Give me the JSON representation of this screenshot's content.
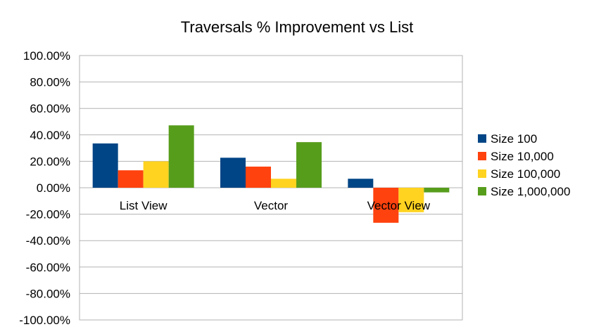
{
  "chart_data": {
    "type": "bar",
    "title": "Traversals % Improvement vs List",
    "categories": [
      "List View",
      "Vector",
      "Vector View"
    ],
    "series": [
      {
        "name": "Size 100",
        "color": "#004586",
        "values": [
          33.5,
          22.7,
          6.8
        ]
      },
      {
        "name": "Size 10,000",
        "color": "#ff420e",
        "values": [
          13.2,
          16.0,
          -26.5
        ]
      },
      {
        "name": "Size 100,000",
        "color": "#ffd320",
        "values": [
          20.0,
          6.8,
          -18.5
        ]
      },
      {
        "name": "Size 1,000,000",
        "color": "#579d1c",
        "values": [
          47.2,
          34.5,
          -3.5
        ]
      }
    ],
    "ylim": [
      -100,
      100
    ],
    "ytick_labels": [
      "100.00%",
      "80.00%",
      "60.00%",
      "40.00%",
      "20.00%",
      "0.00%",
      "-20.00%",
      "-40.00%",
      "-60.00%",
      "-80.00%",
      "-100.00%"
    ],
    "ytick_values": [
      100,
      80,
      60,
      40,
      20,
      0,
      -20,
      -40,
      -60,
      -80,
      -100
    ],
    "xlabel": "",
    "ylabel": "",
    "grid": true,
    "legend": "right"
  }
}
